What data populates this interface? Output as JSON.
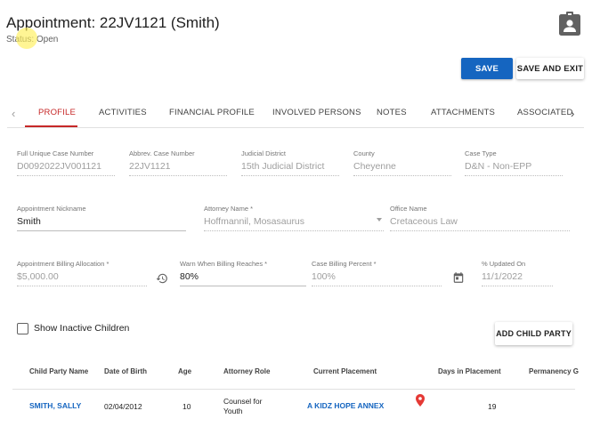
{
  "header": {
    "title": "Appointment: 22JV1121 (Smith)",
    "status": "Status: Open"
  },
  "toolbar": {
    "save_label": "SAVE",
    "save_exit_label": "SAVE AND EXIT"
  },
  "tabs": [
    {
      "label": "PROFILE",
      "active": true
    },
    {
      "label": "ACTIVITIES"
    },
    {
      "label": "FINANCIAL PROFILE"
    },
    {
      "label": "INVOLVED PERSONS"
    },
    {
      "label": "NOTES"
    },
    {
      "label": "ATTACHMENTS"
    },
    {
      "label": "ASSOCIATED"
    }
  ],
  "case_info": {
    "full_case_number": {
      "label": "Full Unique Case Number",
      "value": "D0092022JV001121"
    },
    "abbrev_case_number": {
      "label": "Abbrev. Case Number",
      "value": "22JV1121"
    },
    "judicial_district": {
      "label": "Judicial District",
      "value": "15th Judicial District"
    },
    "county": {
      "label": "County",
      "value": "Cheyenne"
    },
    "case_type": {
      "label": "Case Type",
      "value": "D&N - Non-EPP"
    }
  },
  "appointment": {
    "nickname": {
      "label": "Appointment Nickname",
      "value": "Smith"
    },
    "attorney_name": {
      "label": "Attorney Name *",
      "value": "Hoffmannil, Mosasaurus"
    },
    "office_name": {
      "label": "Office Name",
      "value": "Cretaceous Law"
    }
  },
  "billing": {
    "allocation": {
      "label": "Appointment Billing Allocation *",
      "value": "$5,000.00"
    },
    "warn_when": {
      "label": "Warn When Billing Reaches *",
      "value": "80%"
    },
    "case_billing_percent": {
      "label": "Case Billing Percent *",
      "value": "100%"
    },
    "percent_updated_on": {
      "label": "% Updated On",
      "value": "11/1/2022"
    }
  },
  "children": {
    "show_inactive_label": "Show Inactive Children",
    "show_inactive_checked": false,
    "add_child_label": "ADD CHILD PARTY",
    "columns": [
      "Child Party Name",
      "Date of Birth",
      "Age",
      "Attorney Role",
      "Current Placement",
      "Days in Placement",
      "Permanency G"
    ],
    "rows": [
      {
        "name": "SMITH, SALLY",
        "dob": "02/04/2012",
        "age": "10",
        "role_line1": "Counsel for",
        "role_line2": "Youth",
        "placement": "A KIDZ HOPE ANNEX",
        "days": "19"
      }
    ]
  },
  "colors": {
    "primary": "#1565c0",
    "active_tab": "#c62828"
  },
  "icons": {
    "profile": "account-badge-icon",
    "history": "history-icon",
    "calendar": "calendar-icon",
    "location": "location-pin-icon",
    "tab_prev": "chevron-left-icon",
    "tab_next": "chevron-right-icon"
  }
}
